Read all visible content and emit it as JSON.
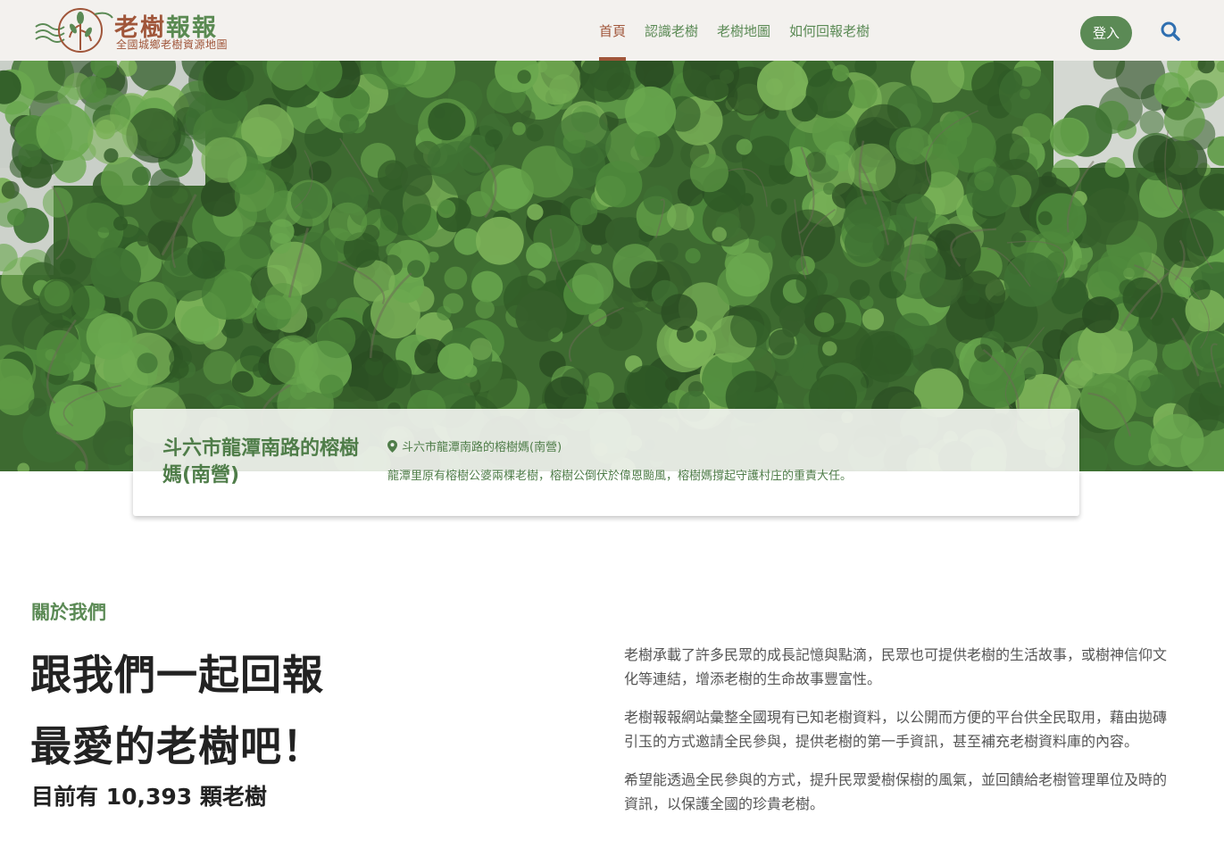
{
  "header": {
    "logo": {
      "title_part1": "老樹",
      "title_part2": "報報",
      "subtitle": "全國城鄉老樹資源地圖"
    },
    "nav": [
      {
        "label": "首頁",
        "active": true
      },
      {
        "label": "認識老樹",
        "active": false
      },
      {
        "label": "老樹地圖",
        "active": false
      },
      {
        "label": "如何回報老樹",
        "active": false
      }
    ],
    "login_label": "登入",
    "search_icon": "search-icon"
  },
  "hero": {
    "image": "banyan-tree-canopy-photo",
    "feature": {
      "title": "斗六市龍潭南路的榕樹媽(南營)",
      "location": "斗六市龍潭南路的榕樹媽(南營)",
      "location_icon": "map-pin-icon",
      "description": "龍潭里原有榕樹公婆兩棵老樹，榕樹公倒伏於偉恩颱風，榕樹媽撐起守護村庄的重責大任。"
    }
  },
  "about": {
    "eyebrow": "關於我們",
    "heading_line1": "跟我們一起回報",
    "heading_line2": "最愛的老樹吧！",
    "tree_count_text": "目前有 10,393 顆老樹",
    "paragraphs": [
      "老樹承載了許多民眾的成長記憶與點滴，民眾也可提供老樹的生活故事，或樹神信仰文化等連結，增添老樹的生命故事豐富性。",
      "老樹報報網站彙整全國現有已知老樹資料，以公開而方便的平台供全民取用，藉由拋磚引玉的方式邀請全民參與，提供老樹的第一手資訊，甚至補充老樹資料庫的內容。",
      "希望能透過全民參與的方式，提升民眾愛樹保樹的風氣，並回饋給老樹管理單位及時的資訊，以保護全國的珍貴老樹。"
    ]
  },
  "colors": {
    "brand_brown": "#a0563a",
    "brand_green": "#5b8a55",
    "header_bg": "#f3f1ee"
  }
}
